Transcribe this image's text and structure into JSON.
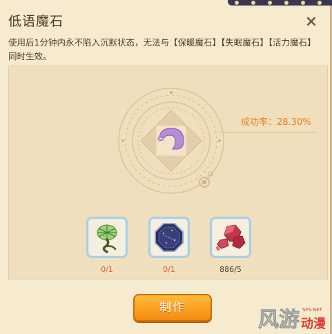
{
  "dialog": {
    "title": "低语魔石",
    "close_label": "×",
    "description": "使用后1分钟内永不陷入沉默状态，无法与【保暖魔石】【失眠魔石】【活力魔石】同时生效。"
  },
  "craft": {
    "success_rate_label": "成功率：28.30%",
    "materials": [
      {
        "icon": "herb-plant-icon",
        "count": "0/1",
        "insufficient": true
      },
      {
        "icon": "dark-crystal-icon",
        "count": "0/1",
        "insufficient": true
      },
      {
        "icon": "red-ore-icon",
        "count": "886/5",
        "insufficient": false
      }
    ],
    "make_button": "制作"
  },
  "watermark": {
    "text": "风游动漫",
    "domain": "SFS.NET"
  },
  "colors": {
    "accent": "#ee7b22",
    "button": "#f58a12",
    "slot_border": "#a9cfe4",
    "panel_bg": "#f6ebcf"
  }
}
